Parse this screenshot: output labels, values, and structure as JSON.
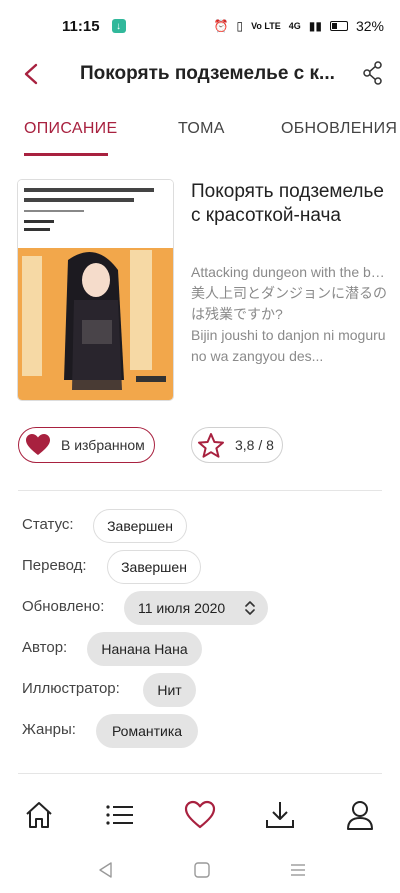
{
  "status_bar": {
    "time": "11:15",
    "network": "Vo LTE",
    "signal_label": "4G",
    "battery": "32%"
  },
  "header": {
    "title": "Покорять подземелье с к..."
  },
  "tabs": [
    {
      "label": "ОПИСАНИЕ",
      "active": true
    },
    {
      "label": "ТОМА",
      "active": false
    },
    {
      "label": "ОБНОВЛЕНИЯ",
      "active": false
    }
  ],
  "book": {
    "title": "Покорять подземелье с красоткой-нача",
    "alt_titles": [
      "Attacking dungeon with the beautiful boss is overtime w...",
      "美人上司とダンジョンに潜るのは残業ですか?",
      "Bijin joushi to danjon ni moguru no wa zangyou des..."
    ]
  },
  "actions": {
    "favorite_label": "В избранном",
    "rating_label": "3,8 / 8"
  },
  "details": {
    "status_label": "Статус:",
    "status_value": "Завершен",
    "translation_label": "Перевод:",
    "translation_value": "Завершен",
    "updated_label": "Обновлено:",
    "updated_value": "11 июля 2020",
    "author_label": "Автор:",
    "author_value": "Нанана Нана",
    "illustrator_label": "Иллюстратор:",
    "illustrator_value": "Нит",
    "genres_label": "Жанры:",
    "genres_value": "Романтика"
  },
  "colors": {
    "accent": "#a8213f",
    "chip_fill": "#e4e4e4",
    "muted_text": "#8a8a8a"
  },
  "icons": {
    "back": "chevron-left-icon",
    "share": "share-icon",
    "home": "home-icon",
    "list": "list-icon",
    "favorites": "heart-icon",
    "downloads": "download-icon",
    "profile": "user-icon"
  }
}
